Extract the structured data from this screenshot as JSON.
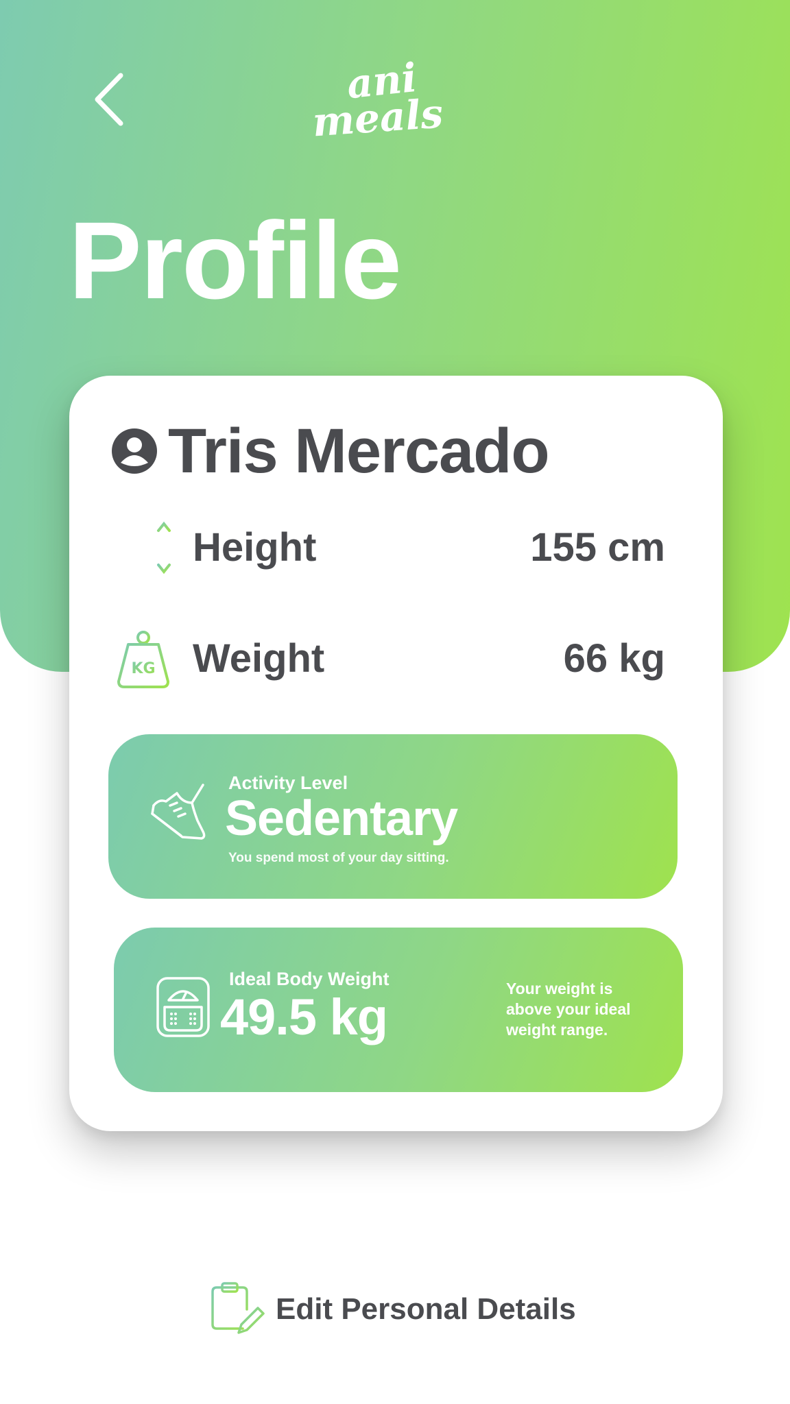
{
  "header": {
    "back_label": "Back",
    "logo_line1": "ani",
    "logo_line2": "meals",
    "title": "Profile"
  },
  "profile": {
    "name": "Tris Mercado",
    "stats": [
      {
        "label": "Height",
        "value": "155 cm",
        "icon": "height-icon"
      },
      {
        "label": "Weight",
        "value": "66 kg",
        "icon": "weight-kg-icon"
      }
    ],
    "weight_icon_text": "KG"
  },
  "activity": {
    "caption": "Activity Level",
    "level": "Sedentary",
    "description": "You spend most of your day sitting.",
    "icon": "shoe-icon"
  },
  "ideal_weight": {
    "caption": "Ideal Body Weight",
    "value": "49.5 kg",
    "note": "Your weight is above your ideal weight range.",
    "icon": "scale-icon"
  },
  "footer": {
    "edit_label": "Edit Personal Details",
    "icon": "clipboard-edit-icon"
  },
  "colors": {
    "gradient_start": "#7ecbb0",
    "gradient_end": "#9fe34f",
    "text_dark": "#4a4b4f",
    "white": "#ffffff"
  }
}
